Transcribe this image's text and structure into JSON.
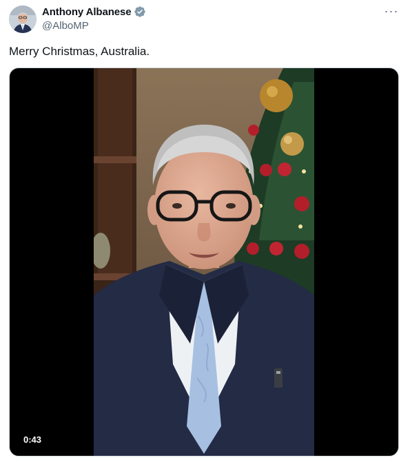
{
  "author": {
    "name": "Anthony Albanese",
    "handle": "@AlboMP",
    "verified_icon": "verified-badge-icon"
  },
  "tweet": {
    "text": "Merry Christmas, Australia."
  },
  "menu": {
    "icon": "more-options-icon",
    "glyph": "···"
  },
  "video": {
    "duration": "0:43"
  },
  "colors": {
    "verified": "#1d9bf0",
    "secondary_text": "#536471",
    "suit": "#232b45",
    "tie": "#a7c0e2"
  }
}
